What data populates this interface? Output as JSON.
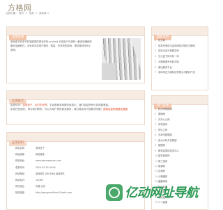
{
  "site": {
    "logo": "方格网"
  },
  "breadcrumb": [
    "当前位置：",
    "首页",
    " > ",
    "全部",
    " > ",
    "游戏库 > "
  ],
  "detail": {
    "title": "应用详情",
    "description": "游戏盒子安卓手机端能提供很多好玩 android 手游用户可选的一套游戏赚款的最好运营软件。为安卓手机用户服务，数量、多样类的游戏，提供各种好玩小游戏。"
  },
  "tip": {
    "title": "友情提示",
    "line1_prefix": "如您访问：",
    "line1_red": "游戏盒子 - 你们的世界",
    "line1_rest": "，平台推荐游戏服务免费中，我们欢迎所有小游戏喜爱者。",
    "line2_prefix": "如您在找到的，请与我们联系，可以为用户提供更多服务，我们将及时为您解决问题！",
    "line2_hl": "资质认证申请提交链接"
  },
  "info": {
    "title": "应用资料",
    "rows": [
      {
        "key": "网站名称：",
        "value": "游戏盒子"
      },
      {
        "key": "网站链接：",
        "value": "网站链接"
      },
      {
        "key": "网站地址：",
        "value": "www.gamepocsen.com"
      },
      {
        "key": "收录时间：",
        "value": "2024-05-29 08:05"
      },
      {
        "key": "网站概括：",
        "value": "游戏软件 [IRC/Net] 最新软件"
      },
      {
        "key": "网站标识：",
        "value": "1ZQ8P"
      },
      {
        "key": "所在地区：",
        "value": "中国 北京"
      },
      {
        "key": "相关链接：",
        "value": "http://wangsouthhao2.jbotn.com"
      }
    ]
  },
  "recommend": {
    "title": "最新应用",
    "items": [
      {
        "num": "1",
        "label": "引力网"
      },
      {
        "num": "2",
        "label": "信易号电信与高效网络互联的方格网"
      },
      {
        "num": "3",
        "label": "前进大会气象服务网"
      },
      {
        "num": "4",
        "label": "长泛盒子网手机一体"
      },
      {
        "num": "5",
        "label": "大鹰暖通专业制冷网"
      },
      {
        "num": "6",
        "label": "南坛服务平台"
      },
      {
        "num": "7",
        "label": "深圳申达光源科技有限公司数码产品"
      }
    ]
  },
  "popular": {
    "title": "热门应用",
    "items": [
      {
        "num": "1",
        "label": "杭州市残疾网"
      },
      {
        "num": "2",
        "label": "看懂网"
      },
      {
        "num": "3",
        "label": "开开心心网"
      },
      {
        "num": "4",
        "label": "体育游戏"
      },
      {
        "num": "5",
        "label": "快乐之家"
      },
      {
        "num": "6",
        "label": "天津市数据图"
      },
      {
        "num": "7",
        "label": "西北水利文化集团"
      },
      {
        "num": "8",
        "label": "数据网"
      },
      {
        "num": "9",
        "label": "格林豪泰网发送中心"
      },
      {
        "num": "10",
        "label": "建材家居网"
      },
      {
        "num": "11",
        "label": "厚工招商"
      },
      {
        "num": "12",
        "label": "普通网"
      },
      {
        "num": "13",
        "label": "百相网"
      },
      {
        "num": "14",
        "label": "小猪赚钱"
      },
      {
        "num": "15",
        "label": "盛趣网络"
      },
      {
        "num": "16",
        "label": "快乐转码"
      },
      {
        "num": "17",
        "label": "世界网"
      },
      {
        "num": "18",
        "label": "电站组件网"
      },
      {
        "num": "19",
        "label": "人人健康"
      }
    ]
  },
  "watermark": {
    "text": "亿动网址导航"
  }
}
